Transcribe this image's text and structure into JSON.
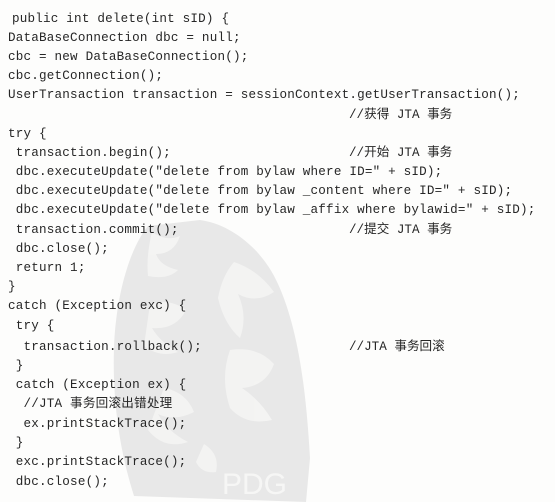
{
  "code": {
    "lines": [
      "public int delete(int sID) {",
      "DataBaseConnection dbc = null;",
      "cbc = new DataBaseConnection();",
      "cbc.getConnection();",
      "UserTransaction transaction = sessionContext.getUserTransaction();",
      "",
      "try {",
      " transaction.begin();",
      " dbc.executeUpdate(\"delete from bylaw where ID=\" + sID);",
      " dbc.executeUpdate(\"delete from bylaw _content where ID=\" + sID);",
      " dbc.executeUpdate(\"delete from bylaw _affix where bylawid=\" + sID);",
      " transaction.commit();",
      " dbc.close();",
      " return 1;",
      "}",
      "catch (Exception exc) {",
      " try {",
      "  transaction.rollback();",
      " }",
      " catch (Exception ex) {",
      "  //JTA 事务回滚出错处理",
      "  ex.printStackTrace();",
      " }",
      " exc.printStackTrace();",
      " dbc.close();"
    ],
    "comments": {
      "get_jta": "//获得 JTA 事务",
      "begin_jta": "//开始 JTA 事务",
      "commit_jta": "//提交 JTA 事务",
      "rollback_jta": "//JTA 事务回滚"
    }
  },
  "watermark": {
    "text": "PDG"
  },
  "colors": {
    "ink": "#262626",
    "paper": "#fdfdfc",
    "seal_gray": "#d7d7d7"
  }
}
